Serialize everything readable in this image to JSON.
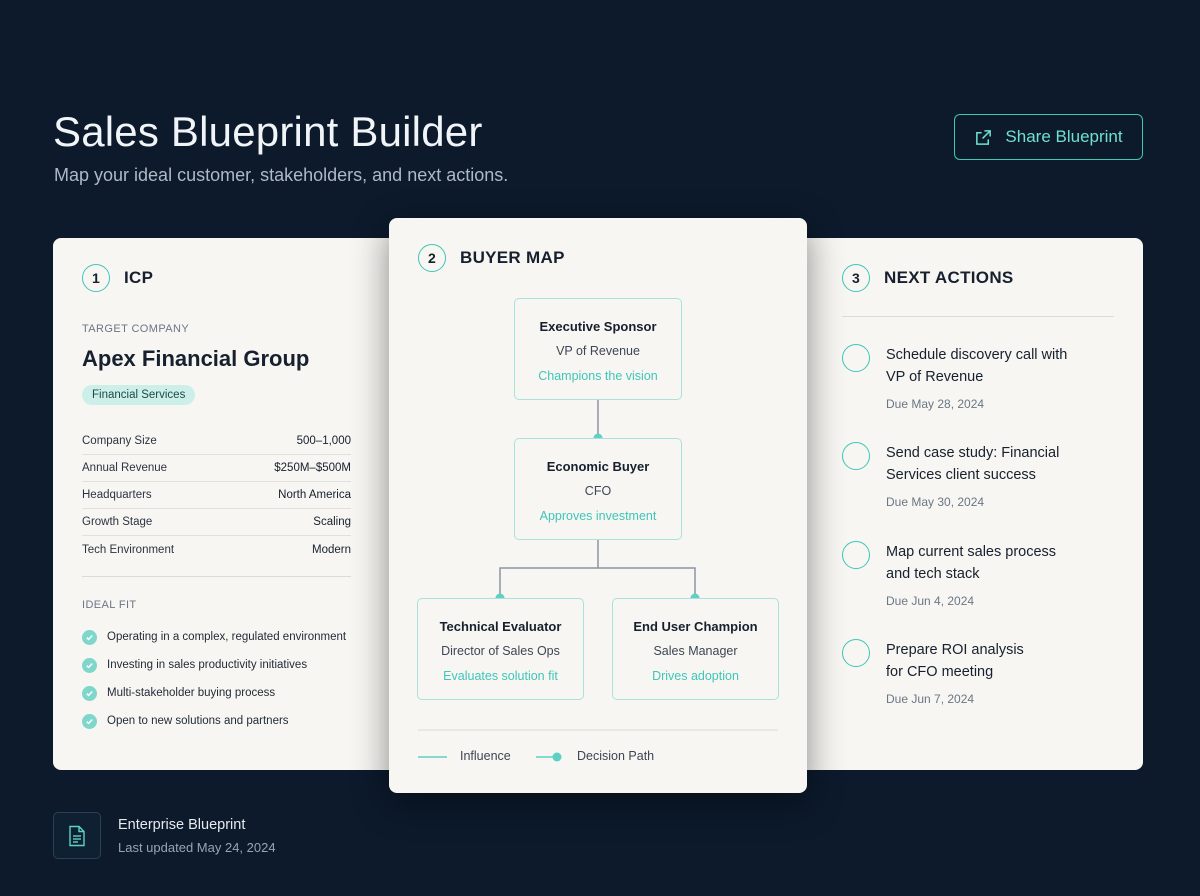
{
  "header": {
    "title": "Sales Blueprint Builder",
    "subtitle": "Map your ideal customer, stakeholders, and next actions.",
    "share_label": "Share Blueprint"
  },
  "icp": {
    "step_num": "1",
    "step_label": "ICP",
    "target_label": "TARGET COMPANY",
    "company": "Apex Financial Group",
    "industry": "Financial Services",
    "attributes": [
      {
        "label": "Company Size",
        "value": "500–1,000"
      },
      {
        "label": "Annual Revenue",
        "value": "$250M–$500M"
      },
      {
        "label": "Headquarters",
        "value": "North America"
      },
      {
        "label": "Growth Stage",
        "value": "Scaling"
      },
      {
        "label": "Tech Environment",
        "value": "Modern"
      }
    ],
    "fit_label": "IDEAL FIT",
    "fit": [
      "Operating in a complex, regulated environment",
      "Investing in sales productivity initiatives",
      "Multi-stakeholder buying process",
      "Open to new solutions and partners"
    ]
  },
  "buyer_map": {
    "step_num": "2",
    "step_label": "BUYER MAP",
    "nodes": [
      {
        "title": "Executive Sponsor",
        "role": "VP of Revenue",
        "note": "Champions the vision"
      },
      {
        "title": "Economic Buyer",
        "role": "CFO",
        "note": "Approves investment"
      },
      {
        "title": "Technical Evaluator",
        "role": "Director of Sales Ops",
        "note": "Evaluates solution fit"
      },
      {
        "title": "End User Champion",
        "role": "Sales Manager",
        "note": "Drives adoption"
      }
    ],
    "legend": {
      "influence": "Influence",
      "decision": "Decision Path"
    },
    "colors": {
      "accent": "#3fc6b8",
      "line": "#8a95a3"
    }
  },
  "next_actions": {
    "step_num": "3",
    "step_label": "NEXT ACTIONS",
    "items": [
      {
        "line1": "Schedule discovery call with",
        "line2": "VP of Revenue",
        "due": "Due May 28, 2024"
      },
      {
        "line1": "Send case study: Financial",
        "line2": "Services client success",
        "due": "Due May 30, 2024"
      },
      {
        "line1": "Map current sales process",
        "line2": "and tech stack",
        "due": "Due Jun 4, 2024"
      },
      {
        "line1": "Prepare ROI analysis",
        "line2": "for CFO meeting",
        "due": "Due Jun 7, 2024"
      }
    ]
  },
  "footer": {
    "title": "Enterprise Blueprint",
    "updated": "Last updated May 24, 2024",
    "icon": "document-icon"
  }
}
